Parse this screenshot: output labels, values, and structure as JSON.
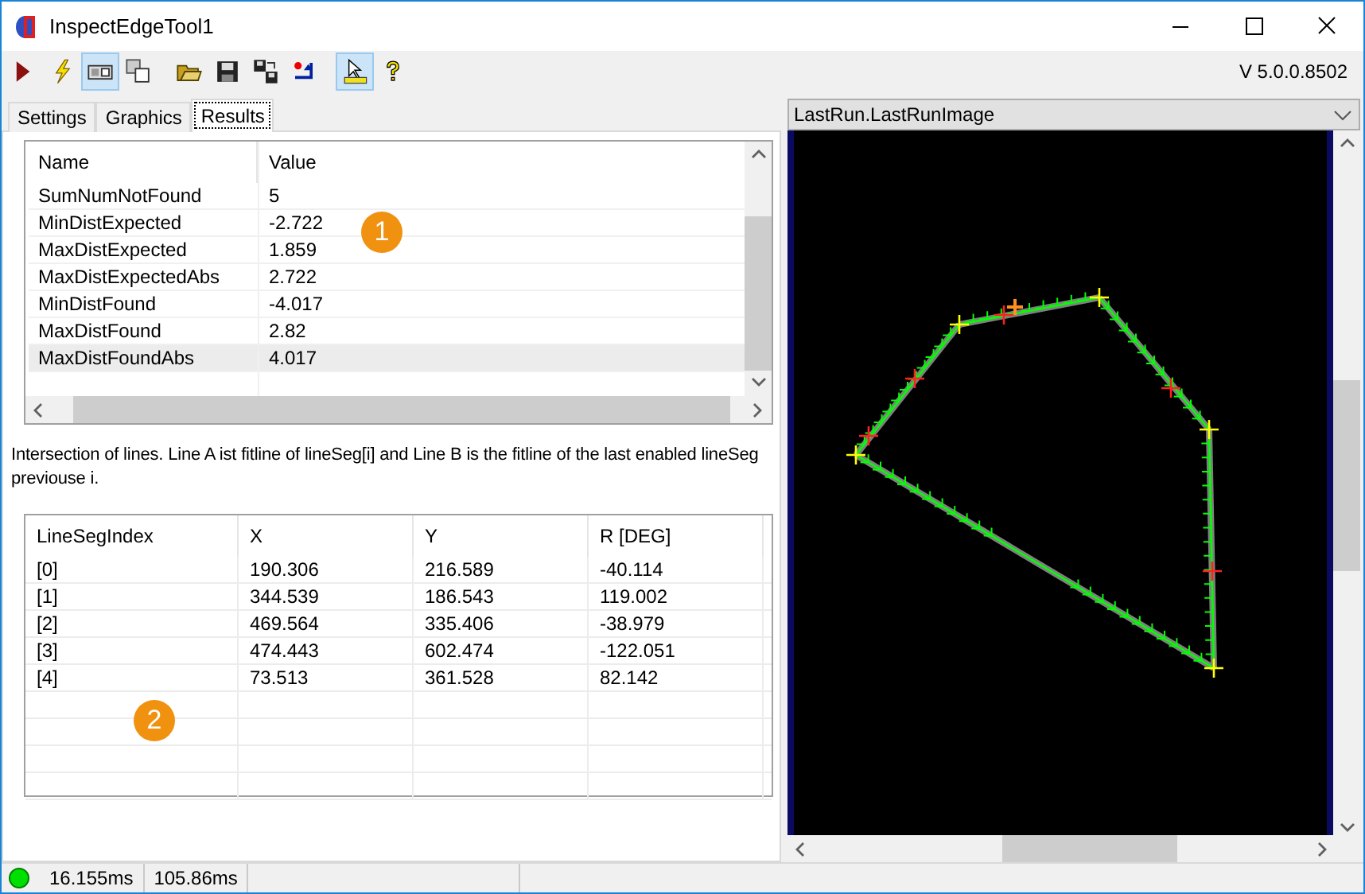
{
  "window": {
    "title": "InspectEdgeTool1"
  },
  "toolbar": {
    "buttons": [
      {
        "selected": false
      },
      {
        "selected": false
      },
      {
        "selected": true
      },
      {
        "selected": false
      },
      {
        "selected": false
      },
      {
        "selected": false
      },
      {
        "selected": false
      },
      {
        "selected": false
      },
      {
        "selected": true
      },
      {
        "selected": false
      }
    ],
    "version": "V 5.0.0.8502"
  },
  "tabs": [
    {
      "label": "Settings",
      "selected": false
    },
    {
      "label": "Graphics",
      "selected": false
    },
    {
      "label": "Results",
      "selected": true
    }
  ],
  "results_table": {
    "columns": [
      "Name",
      "Value"
    ],
    "rows": [
      {
        "cells": [
          "SumNumNotFound",
          "5"
        ],
        "selected": false
      },
      {
        "cells": [
          "MinDistExpected",
          "-2.722"
        ],
        "selected": false
      },
      {
        "cells": [
          "MaxDistExpected",
          "1.859"
        ],
        "selected": false
      },
      {
        "cells": [
          "MaxDistExpectedAbs",
          "2.722"
        ],
        "selected": false
      },
      {
        "cells": [
          "MinDistFound",
          "-4.017"
        ],
        "selected": false
      },
      {
        "cells": [
          "MaxDistFound",
          "2.82"
        ],
        "selected": false
      },
      {
        "cells": [
          "MaxDistFoundAbs",
          "4.017"
        ],
        "selected": true
      }
    ]
  },
  "description": "Intersection of lines. Line A ist fitline of lineSeg[i] and Line B is the fitline of the last enabled lineSeg previouse i.",
  "intersections_table": {
    "columns": [
      "LineSegIndex",
      "X",
      "Y",
      "R [DEG]"
    ],
    "rows": [
      [
        "[0]",
        "190.306",
        "216.589",
        "-40.114"
      ],
      [
        "[1]",
        "344.539",
        "186.543",
        "119.002"
      ],
      [
        "[2]",
        "469.564",
        "335.406",
        "-38.979"
      ],
      [
        "[3]",
        "474.443",
        "602.474",
        "-122.051"
      ],
      [
        "[4]",
        "73.513",
        "361.528",
        "82.142"
      ]
    ]
  },
  "image_view": {
    "source": "LastRun.LastRunImage"
  },
  "callouts": [
    "1",
    "2"
  ],
  "status_bar": {
    "times": [
      "16.155ms",
      "105.86ms"
    ]
  }
}
